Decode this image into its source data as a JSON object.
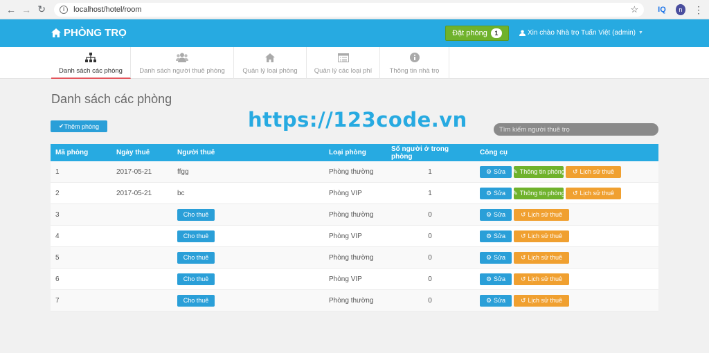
{
  "browser": {
    "url": "localhost/hotel/room",
    "ext_label": "IQ",
    "profile_initial": "n"
  },
  "header": {
    "brand": "PHÒNG TRỌ",
    "book_label": "Đặt phòng",
    "book_count": "1",
    "user_greeting": "Xin chào Nhà trọ Tuấn Việt (admin)"
  },
  "tabs": [
    {
      "label": "Danh sách các phòng"
    },
    {
      "label": "Danh sách người thuê phòng"
    },
    {
      "label": "Quản lý loại phòng"
    },
    {
      "label": "Quản lý các loại phí"
    },
    {
      "label": "Thông tin nhà trọ"
    }
  ],
  "main": {
    "title": "Danh sách các phòng",
    "add_label": "Thêm phòng",
    "watermark": "https://123code.vn",
    "search_placeholder": "Tìm kiếm người thuê trọ"
  },
  "table": {
    "headers": {
      "id": "Mã phòng",
      "date": "Ngày thuê",
      "tenant": "Người thuê",
      "type": "Loại phòng",
      "count": "Số người ở trong phòng",
      "tools": "Công cụ"
    },
    "rent_label": "Cho thuê",
    "edit_label": "Sửa",
    "info_label": "Thông tin phòng",
    "history_label": "Lịch sử thuê",
    "rows": [
      {
        "id": "1",
        "date": "2017-05-21",
        "tenant": "ffgg",
        "type": "Phòng thường",
        "count": "1"
      },
      {
        "id": "2",
        "date": "2017-05-21",
        "tenant": "bc",
        "type": "Phòng VIP",
        "count": "1"
      },
      {
        "id": "3",
        "date": "",
        "tenant": "",
        "type": "Phòng thường",
        "count": "0"
      },
      {
        "id": "4",
        "date": "",
        "tenant": "",
        "type": "Phòng VIP",
        "count": "0"
      },
      {
        "id": "5",
        "date": "",
        "tenant": "",
        "type": "Phòng thường",
        "count": "0"
      },
      {
        "id": "6",
        "date": "",
        "tenant": "",
        "type": "Phòng VIP",
        "count": "0"
      },
      {
        "id": "7",
        "date": "",
        "tenant": "",
        "type": "Phòng thường",
        "count": "0"
      }
    ]
  },
  "colors": {
    "primary": "#27aae1",
    "success": "#6fb22c",
    "warning": "#f0a030",
    "active_tab_border": "#e3555c"
  }
}
